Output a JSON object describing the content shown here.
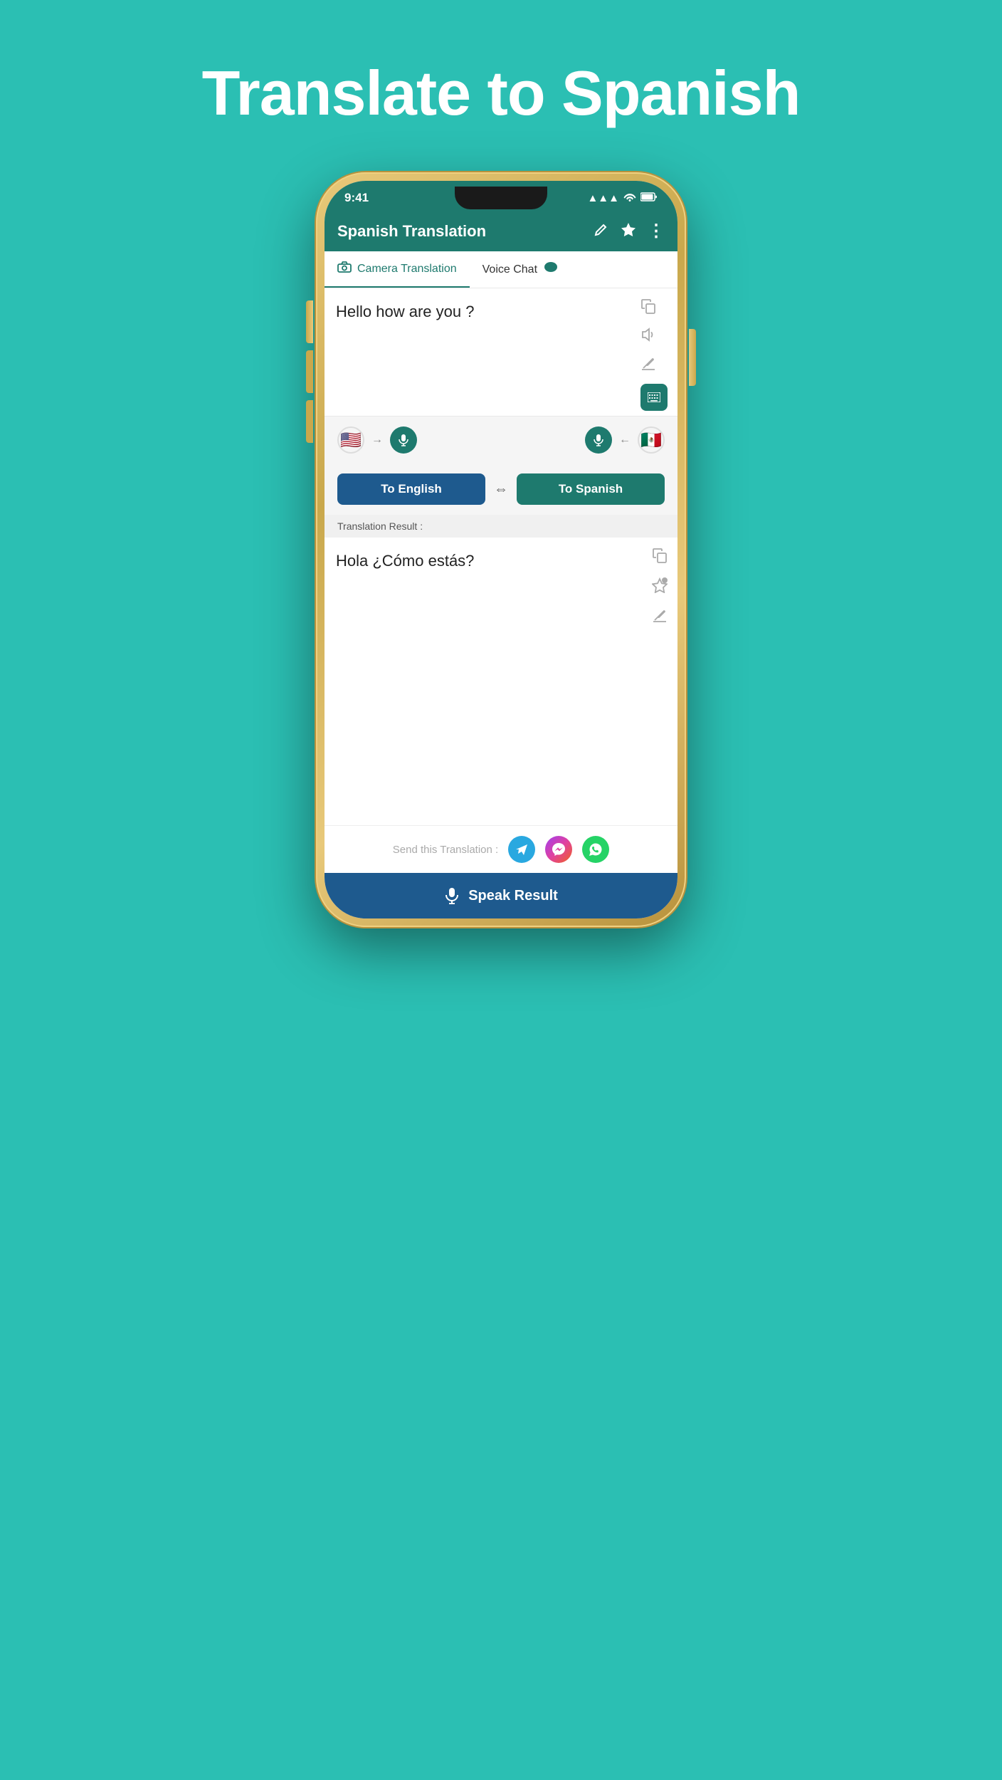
{
  "page": {
    "title": "Translate to Spanish",
    "bg_color": "#2bbfb3"
  },
  "phone": {
    "status_bar": {
      "time": "9:41",
      "signal_icon": "▲▲▲",
      "wifi_icon": "wifi",
      "battery_icon": "battery"
    },
    "header": {
      "title": "Spanish Translation",
      "edit_icon": "✏️",
      "star_icon": "⭐",
      "more_icon": "⋮"
    },
    "tabs": [
      {
        "id": "camera",
        "label": "Camera Translation",
        "icon": "📷",
        "active": true
      },
      {
        "id": "voice",
        "label": "Voice Chat",
        "icon": "💬",
        "active": false
      }
    ],
    "input": {
      "text": "Hello how are you ?",
      "copy_icon": "copy",
      "speaker_icon": "speaker",
      "erase_icon": "erase",
      "keyboard_icon": "keyboard"
    },
    "lang_selector": {
      "left_flag": "🇺🇸",
      "left_mic": "🎤",
      "arrow": "→",
      "right_mic": "🎤",
      "right_arrow": "←",
      "right_flag": "🇲🇽"
    },
    "translation_buttons": {
      "to_english": "To English",
      "to_spanish": "To Spanish",
      "swap_icon": "⇔"
    },
    "result": {
      "label": "Translation Result :",
      "text": "Hola ¿Cómo estás?",
      "copy_icon": "copy",
      "star_icon": "star",
      "erase_icon": "erase"
    },
    "share": {
      "label": "Send this Translation :",
      "telegram_icon": "✈",
      "messenger_icon": "💬",
      "whatsapp_icon": "📱"
    },
    "speak_button": {
      "label": "Speak Result",
      "mic_icon": "🎤"
    }
  }
}
